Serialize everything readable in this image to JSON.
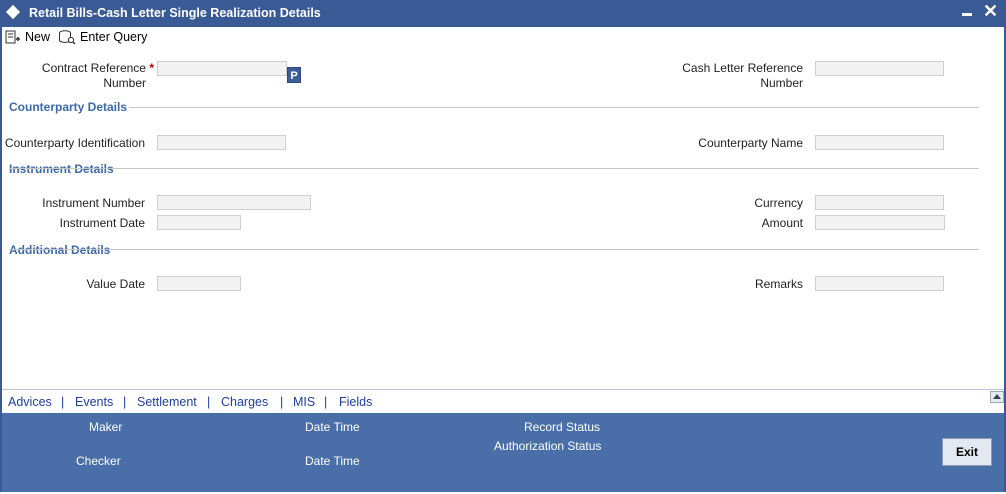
{
  "window": {
    "title": "Retail Bills-Cash Letter Single Realization Details"
  },
  "toolbar": {
    "new_label": "New",
    "enter_query_label": "Enter Query"
  },
  "fields": {
    "contract_reference_number": {
      "label_line1": "Contract Reference",
      "label_line2": "Number",
      "required_mark": "*",
      "value": "",
      "lookup_label": "P"
    },
    "cash_letter_reference_number": {
      "label_line1": "Cash Letter Reference",
      "label_line2": "Number",
      "value": ""
    }
  },
  "sections": {
    "counterparty": {
      "title": "Counterparty Details",
      "counterparty_identification": {
        "label": "Counterparty Identification",
        "value": ""
      },
      "counterparty_name": {
        "label": "Counterparty Name",
        "value": ""
      }
    },
    "instrument": {
      "title": "Instrument Details",
      "instrument_number": {
        "label": "Instrument Number",
        "value": ""
      },
      "instrument_date": {
        "label": "Instrument Date",
        "value": ""
      },
      "currency": {
        "label": "Currency",
        "value": ""
      },
      "amount": {
        "label": "Amount",
        "value": ""
      }
    },
    "additional": {
      "title": "Additional Details",
      "value_date": {
        "label": "Value Date",
        "value": ""
      },
      "remarks": {
        "label": "Remarks",
        "value": ""
      }
    }
  },
  "tabs": [
    {
      "label": "Advices"
    },
    {
      "label": "Events"
    },
    {
      "label": "Settlement"
    },
    {
      "label": "Charges"
    },
    {
      "label": "MIS"
    },
    {
      "label": "Fields"
    }
  ],
  "tab_separator": "|",
  "footer": {
    "maker_label": "Maker",
    "maker_date_time_label": "Date Time",
    "checker_label": "Checker",
    "checker_date_time_label": "Date Time",
    "record_status_label": "Record Status",
    "authorization_status_label": "Authorization Status",
    "exit_label": "Exit"
  },
  "colors": {
    "title_bar": "#3a5a95",
    "section_title": "#3d68a6",
    "footer": "#4a6ea7",
    "tab_link": "#1f3f9a"
  }
}
